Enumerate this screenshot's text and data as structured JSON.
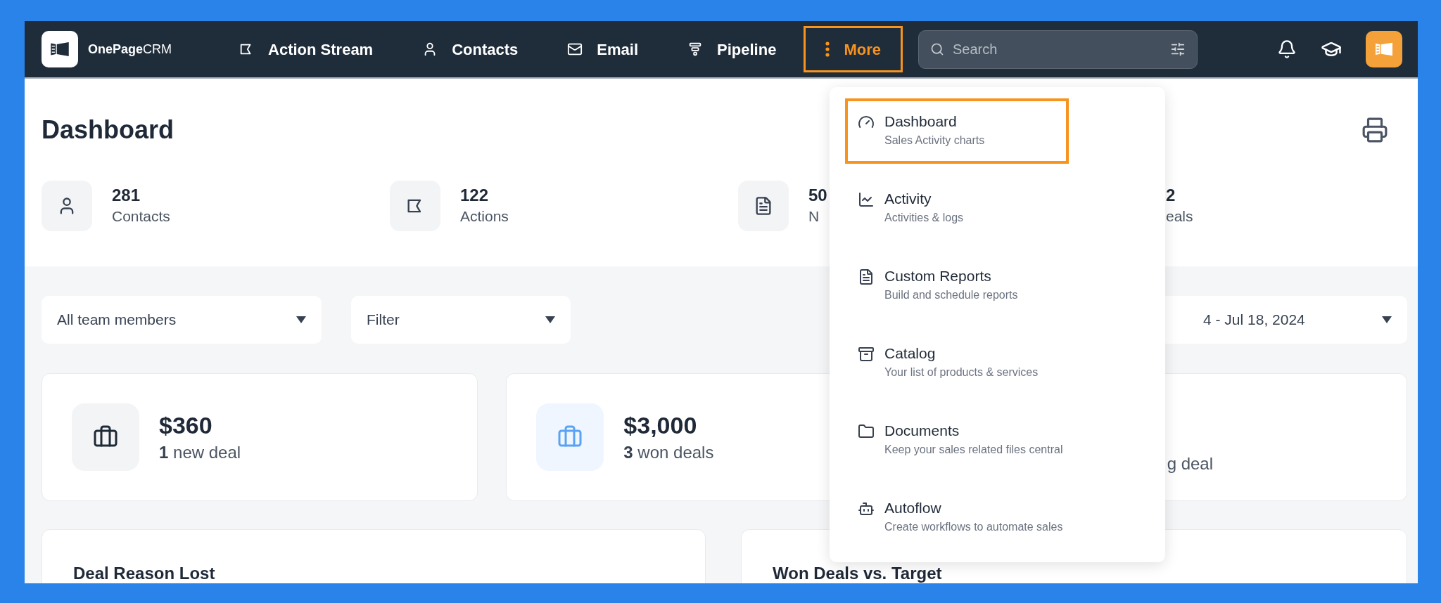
{
  "brand": {
    "name": "OnePage",
    "suffix": "CRM"
  },
  "nav": [
    {
      "label": "Action Stream",
      "selected": false
    },
    {
      "label": "Contacts",
      "selected": false
    },
    {
      "label": "Email",
      "selected": false
    },
    {
      "label": "Pipeline",
      "selected": false
    },
    {
      "label": "More",
      "selected": true
    }
  ],
  "search": {
    "placeholder": "Search"
  },
  "page_title": "Dashboard",
  "stats": [
    {
      "kind": "stat",
      "value": "281",
      "label": "Contacts"
    },
    {
      "kind": "stat",
      "value": "122",
      "label": "Actions"
    },
    {
      "kind": "stat",
      "value": "50",
      "label": "N"
    },
    {
      "kind": "clipped",
      "value": "2",
      "label": "eals"
    }
  ],
  "filters": [
    {
      "label": "All team members"
    },
    {
      "label": "Filter"
    }
  ],
  "date_range": "4 - Jul 18, 2024",
  "deal_cards": [
    {
      "kind": "card",
      "value": "$360",
      "count": "1",
      "label": "new deal",
      "color": "#1f2a37"
    },
    {
      "kind": "card",
      "value": "$3,000",
      "count": "3",
      "label": "won deals",
      "color": "#5aa2f3"
    },
    {
      "kind": "clipped",
      "label": "g deal"
    }
  ],
  "panels": [
    {
      "title": "Deal Reason Lost"
    },
    {
      "title": "Won Deals vs. Target"
    }
  ],
  "menu": [
    {
      "title": "Dashboard",
      "subtitle": "Sales Activity charts",
      "selected": true
    },
    {
      "title": "Activity",
      "subtitle": "Activities & logs",
      "selected": false
    },
    {
      "title": "Custom Reports",
      "subtitle": "Build and schedule reports",
      "selected": false
    },
    {
      "title": "Catalog",
      "subtitle": "Your list of products & services",
      "selected": false
    },
    {
      "title": "Documents",
      "subtitle": "Keep your sales related files central",
      "selected": false
    },
    {
      "title": "Autoflow",
      "subtitle": "Create workflows to automate sales",
      "selected": false
    }
  ]
}
